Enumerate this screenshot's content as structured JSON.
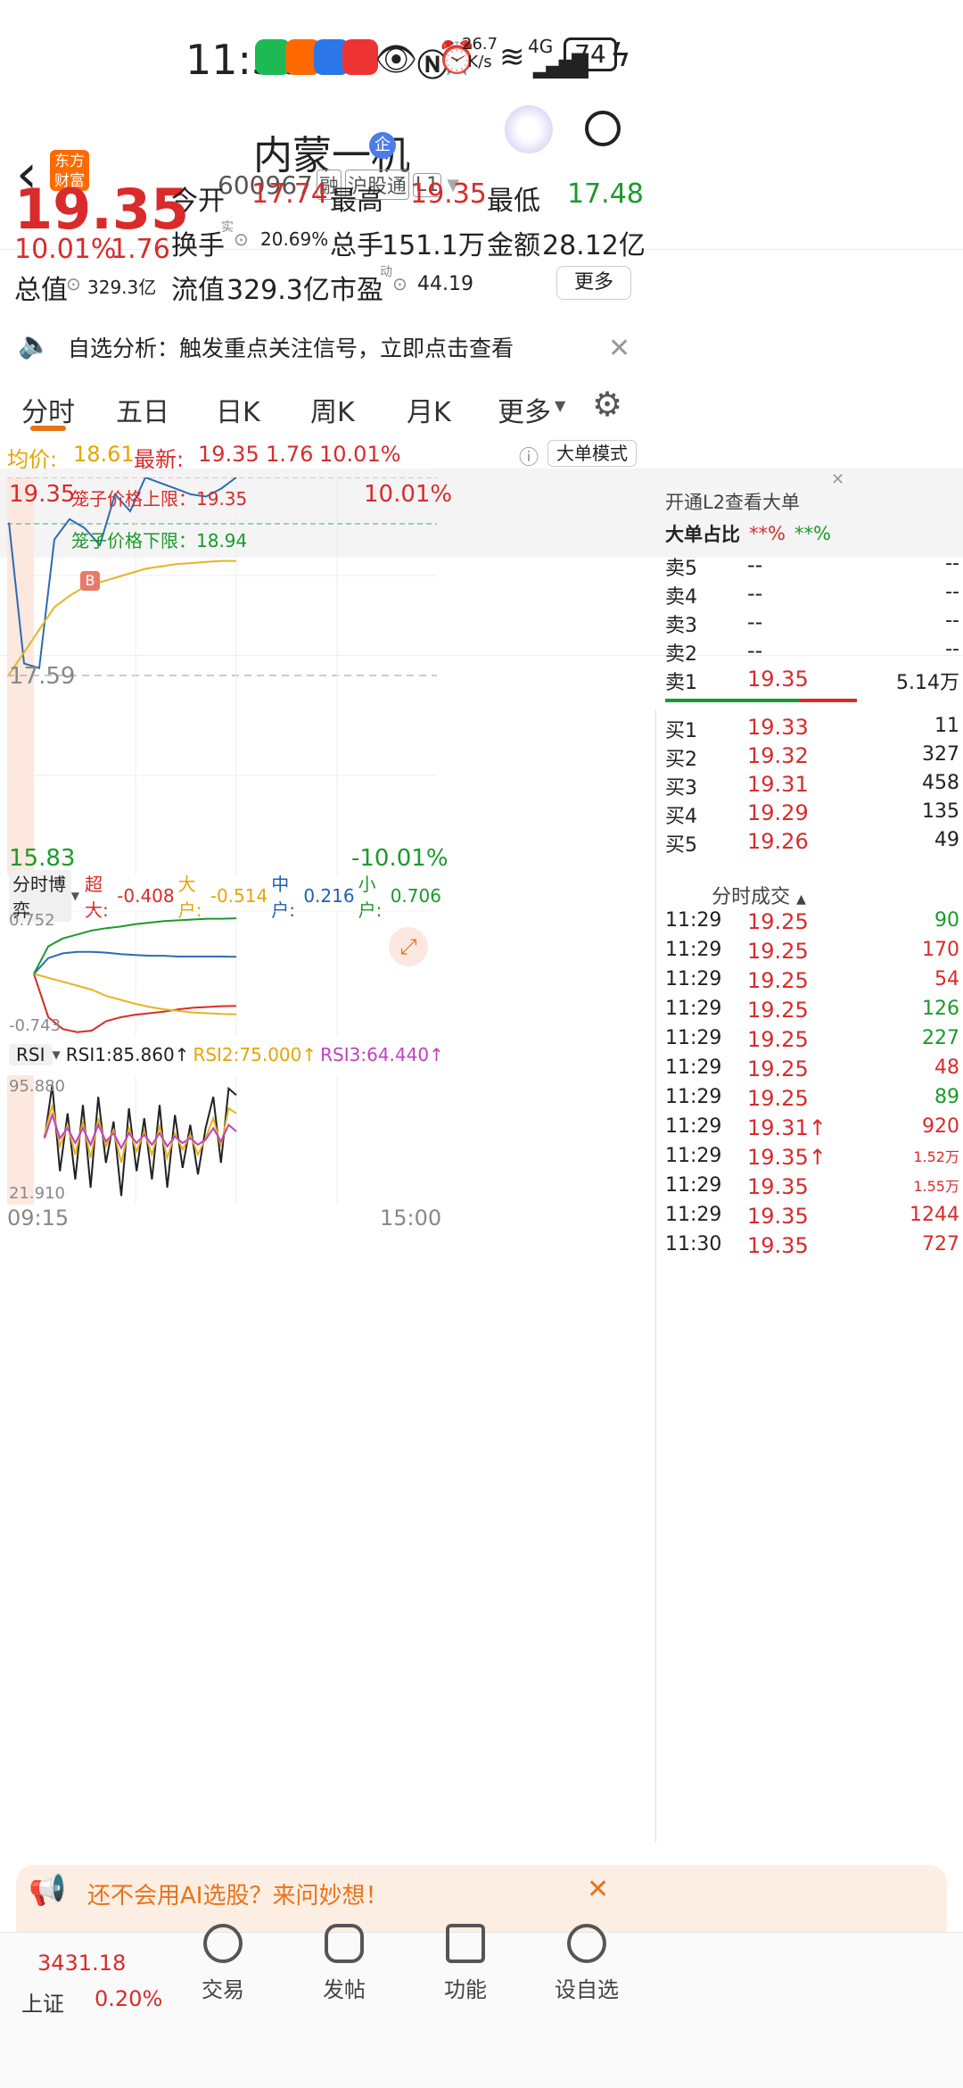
{
  "status": {
    "time": "11:30",
    "net_speed_top": "26.7",
    "net_speed_bottom": "K/s",
    "signal": "4G",
    "battery": "74"
  },
  "header": {
    "logo_line1": "东方",
    "logo_line2": "财富",
    "stock_name": "内蒙一机",
    "badge": "企",
    "code": "600967",
    "tag1": "融",
    "tag2": "沪股通",
    "tag3": "L1"
  },
  "quote": {
    "price": "19.35",
    "pct": "10.01%",
    "change": "1.76",
    "open_label": "今开",
    "open": "17.74",
    "high_label": "最高",
    "high": "19.35",
    "low_label": "最低",
    "low": "17.48",
    "turnover_label": "换手",
    "turnover_sup": "实",
    "turnover": "20.69%",
    "volume_label": "总手",
    "volume": "151.1万",
    "amount_label": "金额",
    "amount": "28.12亿",
    "total_value_label": "总值",
    "total_value": "329.3亿",
    "float_value_label": "流值",
    "float_value": "329.3亿",
    "pe_label": "市盈",
    "pe_sup": "动",
    "pe": "44.19",
    "more_button": "更多"
  },
  "notice": {
    "text": "自选分析：触发重点关注信号，立即点击查看"
  },
  "tabs": [
    "分时",
    "五日",
    "日K",
    "周K",
    "月K",
    "更多"
  ],
  "infobar": {
    "avg_label": "均价:",
    "avg": "18.61",
    "last_label": "最新:",
    "last": "19.35",
    "change": "1.76",
    "pct": "10.01%",
    "mode_button": "大单模式"
  },
  "chart": {
    "y_top": "19.35",
    "y_mid": "17.59",
    "y_bottom": "15.83",
    "pct_top": "10.01%",
    "pct_bottom": "-10.01%",
    "upper_limit_label": "笼子价格上限：19.35",
    "lower_limit_label": "笼子价格下限：18.94",
    "buy_marker": "B",
    "x_start": "09:15",
    "x_end": "15:00"
  },
  "chart_data": [
    {
      "type": "line",
      "title": "",
      "series": [
        {
          "name": "price",
          "color": "#2d6bb5",
          "x": [
            "09:30",
            "09:35",
            "09:40",
            "09:45",
            "09:50",
            "09:55",
            "10:00",
            "10:10",
            "10:20",
            "10:30",
            "10:40",
            "10:50",
            "11:00",
            "11:10",
            "11:20",
            "11:30"
          ],
          "values": [
            18.95,
            17.7,
            17.66,
            18.8,
            18.98,
            18.9,
            18.75,
            19.2,
            19.05,
            19.35,
            19.3,
            19.25,
            19.2,
            19.18,
            19.25,
            19.35
          ]
        },
        {
          "name": "avg",
          "color": "#e6b422",
          "x": [
            "09:30",
            "09:35",
            "09:40",
            "09:45",
            "09:50",
            "09:55",
            "10:00",
            "10:10",
            "10:20",
            "10:30",
            "10:40",
            "10:50",
            "11:00",
            "11:10",
            "11:20",
            "11:30"
          ],
          "values": [
            17.6,
            17.8,
            18.0,
            18.2,
            18.3,
            18.38,
            18.42,
            18.46,
            18.5,
            18.54,
            18.56,
            18.58,
            18.59,
            18.6,
            18.61,
            18.61
          ]
        }
      ],
      "ylim": [
        15.83,
        19.35
      ],
      "xlabel": "",
      "ylabel": ""
    },
    {
      "type": "line",
      "title": "分时博弈",
      "series": [
        {
          "name": "超大",
          "color": "#d92b2b",
          "values": [
            0.0,
            -0.55,
            -0.7,
            -0.74,
            -0.72,
            -0.6,
            -0.55,
            -0.52,
            -0.5,
            -0.48,
            -0.45,
            -0.43,
            -0.42,
            -0.41,
            -0.408
          ]
        },
        {
          "name": "大户",
          "color": "#e6b422",
          "values": [
            0.0,
            -0.05,
            -0.1,
            -0.15,
            -0.2,
            -0.28,
            -0.33,
            -0.38,
            -0.42,
            -0.45,
            -0.47,
            -0.49,
            -0.5,
            -0.51,
            -0.514
          ]
        },
        {
          "name": "中户",
          "color": "#2d6bb5",
          "values": [
            0.0,
            0.2,
            0.26,
            0.28,
            0.28,
            0.27,
            0.25,
            0.24,
            0.23,
            0.23,
            0.22,
            0.22,
            0.22,
            0.22,
            0.216
          ]
        },
        {
          "name": "小户",
          "color": "#1a9a2a",
          "values": [
            0.0,
            0.35,
            0.45,
            0.5,
            0.55,
            0.58,
            0.6,
            0.63,
            0.65,
            0.67,
            0.68,
            0.69,
            0.7,
            0.7,
            0.706
          ]
        }
      ],
      "values_label": {
        "超大": "-0.408",
        "大户": "-0.514",
        "中户": "0.216",
        "小户": "0.706"
      },
      "ylim": [
        -0.743,
        0.752
      ]
    },
    {
      "type": "line",
      "title": "RSI",
      "series": [
        {
          "name": "RSI1",
          "color": "#222222",
          "values": [
            60,
            92,
            40,
            75,
            35,
            80,
            30,
            85,
            45,
            70,
            25,
            78,
            40,
            72,
            35,
            80,
            30,
            74,
            42,
            68,
            38,
            66,
            85,
            45,
            90,
            86
          ]
        },
        {
          "name": "RSI2",
          "color": "#e6b422",
          "values": [
            62,
            80,
            55,
            68,
            50,
            70,
            48,
            72,
            55,
            65,
            45,
            66,
            52,
            64,
            50,
            67,
            48,
            63,
            53,
            62,
            50,
            60,
            72,
            55,
            78,
            75
          ]
        },
        {
          "name": "RSI3",
          "color": "#c040c0",
          "values": [
            60,
            74,
            60,
            66,
            57,
            66,
            56,
            68,
            58,
            63,
            54,
            63,
            57,
            62,
            56,
            63,
            55,
            61,
            57,
            60,
            56,
            59,
            66,
            58,
            68,
            64
          ]
        }
      ],
      "values_label": {
        "RSI1": "85.860",
        "RSI2": "75.000",
        "RSI3": "64.440"
      },
      "ylim": [
        21.91,
        95.88
      ]
    }
  ],
  "subchart1": {
    "selector": "分时博弈",
    "l1": "超大:",
    "v1": "-0.408",
    "l2": "大户:",
    "v2": "-0.514",
    "l3": "中户:",
    "v3": "0.216",
    "l4": "小户:",
    "v4": "0.706",
    "y_top": "0.752",
    "y_bottom": "-0.743"
  },
  "subchart2": {
    "selector": "RSI",
    "r1": "RSI1:85.860↑",
    "r2": "RSI2:75.000↑",
    "r3": "RSI3:64.440↑",
    "y_top": "95.880",
    "y_bottom": "21.910"
  },
  "orderbook": {
    "l2_link": "开通L2查看大单",
    "ratio_label": "大单占比",
    "ratio_red": "**%",
    "ratio_green": "**%",
    "asks": [
      {
        "label": "卖5",
        "price": "--",
        "vol": "--"
      },
      {
        "label": "卖4",
        "price": "--",
        "vol": "--"
      },
      {
        "label": "卖3",
        "price": "--",
        "vol": "--"
      },
      {
        "label": "卖2",
        "price": "--",
        "vol": "--"
      },
      {
        "label": "卖1",
        "price": "19.35",
        "vol": "5.14万"
      }
    ],
    "bids": [
      {
        "label": "买1",
        "price": "19.33",
        "vol": "11"
      },
      {
        "label": "买2",
        "price": "19.32",
        "vol": "327"
      },
      {
        "label": "买3",
        "price": "19.31",
        "vol": "458"
      },
      {
        "label": "买4",
        "price": "19.29",
        "vol": "135"
      },
      {
        "label": "买5",
        "price": "19.26",
        "vol": "49"
      }
    ],
    "trades_title": "分时成交",
    "trades": [
      {
        "time": "11:29",
        "price": "19.25",
        "vol": "90",
        "color": "green"
      },
      {
        "time": "11:29",
        "price": "19.25",
        "vol": "170",
        "color": "red"
      },
      {
        "time": "11:29",
        "price": "19.25",
        "vol": "54",
        "color": "red"
      },
      {
        "time": "11:29",
        "price": "19.25",
        "vol": "126",
        "color": "green"
      },
      {
        "time": "11:29",
        "price": "19.25",
        "vol": "227",
        "color": "green"
      },
      {
        "time": "11:29",
        "price": "19.25",
        "vol": "48",
        "color": "red"
      },
      {
        "time": "11:29",
        "price": "19.25",
        "vol": "89",
        "color": "green"
      },
      {
        "time": "11:29",
        "price": "19.31↑",
        "vol": "920",
        "color": "red"
      },
      {
        "time": "11:29",
        "price": "19.35↑",
        "vol": "1.52万",
        "color": "red"
      },
      {
        "time": "11:29",
        "price": "19.35",
        "vol": "1.55万",
        "color": "red"
      },
      {
        "time": "11:29",
        "price": "19.35",
        "vol": "1244",
        "color": "red"
      },
      {
        "time": "11:30",
        "price": "19.35",
        "vol": "727",
        "color": "red"
      }
    ]
  },
  "banner": {
    "text": "还不会用AI选股？来问妙想！"
  },
  "bottomnav": {
    "index_value": "3431.18",
    "index_name": "上证",
    "index_pct": "0.20%",
    "items": [
      "交易",
      "发帖",
      "功能",
      "设自选"
    ]
  }
}
